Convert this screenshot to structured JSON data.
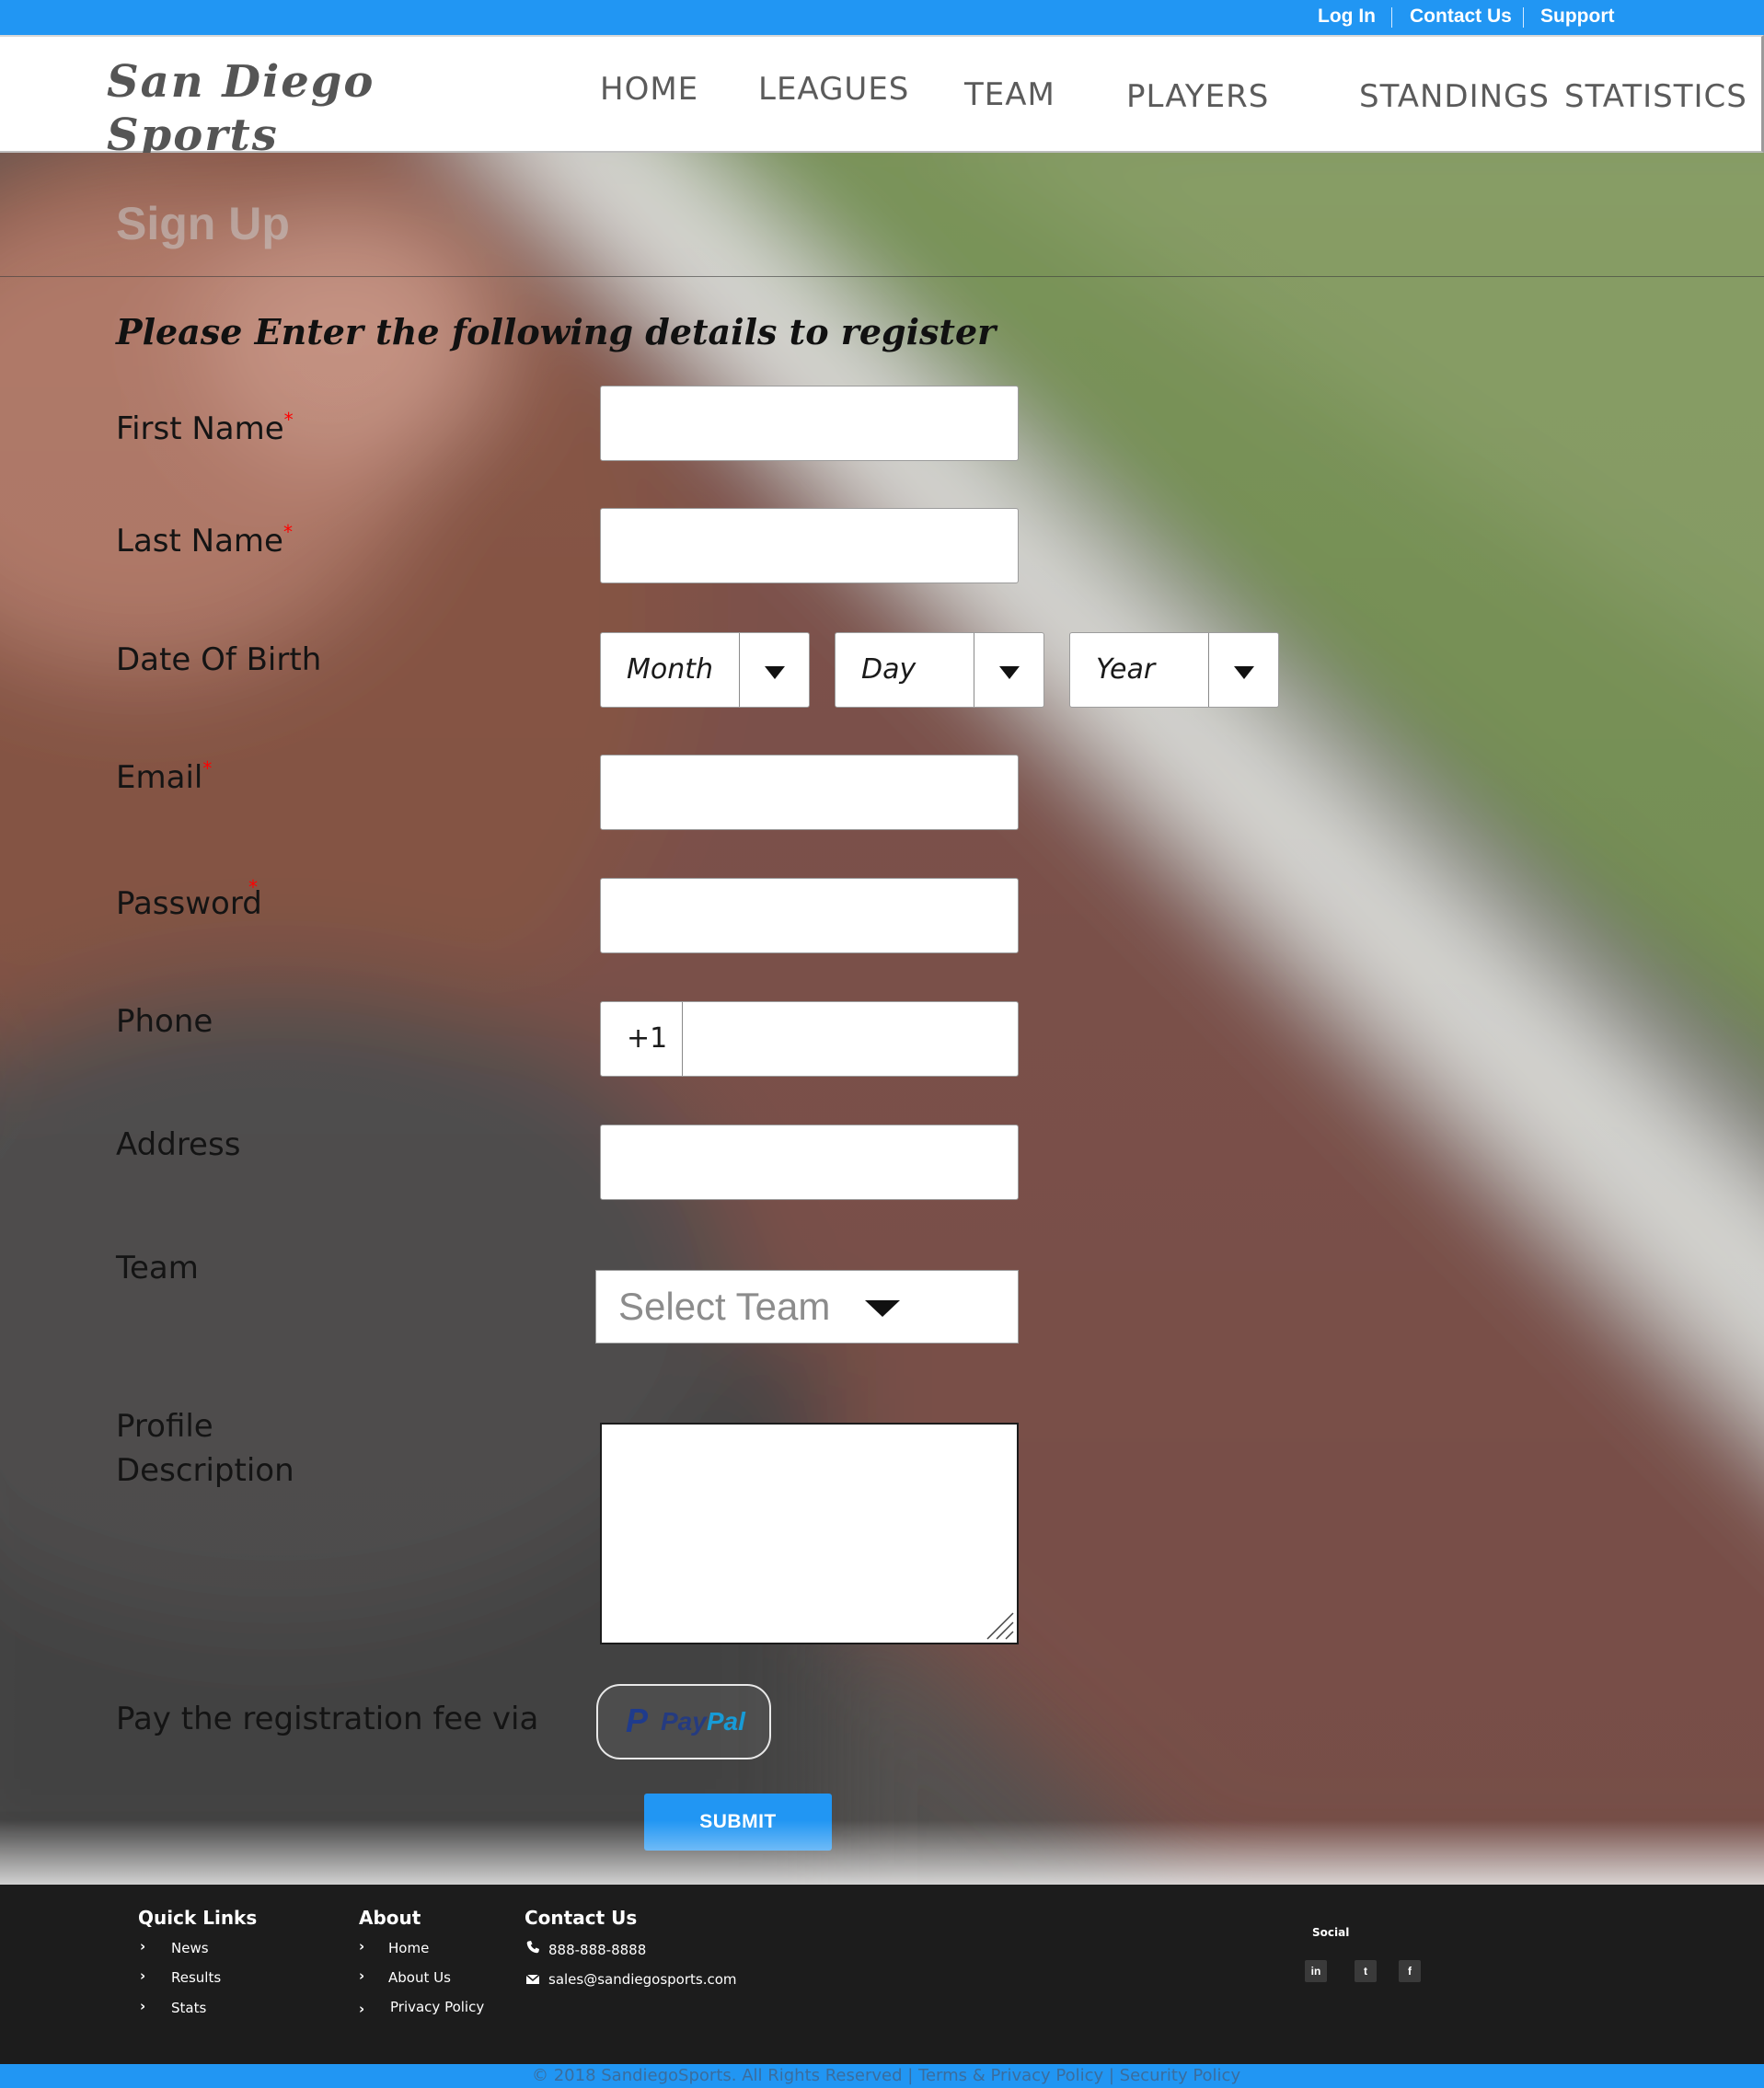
{
  "topbar": {
    "login": "Log In",
    "contact": "Contact Us",
    "support": "Support"
  },
  "brand": {
    "line1": "San Diego",
    "line2": "Sports"
  },
  "nav": [
    "HOME",
    "LEAGUES",
    "TEAM",
    "PLAYERS",
    "STANDINGS",
    "STATISTICS"
  ],
  "page": {
    "title": "Sign Up",
    "instructions": "Please Enter the following details to register"
  },
  "form": {
    "first_name": "First Name",
    "last_name": "Last Name",
    "dob": "Date Of Birth",
    "email": "Email",
    "password": "Password",
    "phone": "Phone",
    "address": "Address",
    "team": "Team",
    "profile_line1": "Profile",
    "profile_line2": "Description",
    "pay": "Pay the registration fee via",
    "required_mark": "*",
    "dob_month": "Month",
    "dob_day": "Day",
    "dob_year": "Year",
    "phone_code": "+1",
    "team_placeholder": "Select Team",
    "paypal_pay": "Pay",
    "paypal_pal": "Pal",
    "submit": "SUBMIT"
  },
  "footer": {
    "quick_links": {
      "heading": "Quick Links",
      "items": [
        "News",
        "Results",
        "Stats"
      ]
    },
    "about": {
      "heading": "About",
      "items": [
        "Home",
        "About Us",
        "Privacy Policy"
      ]
    },
    "contact": {
      "heading": "Contact Us",
      "phone": "888-888-8888",
      "email": "sales@sandiegosports.com"
    },
    "social": {
      "heading": "Social",
      "icons": [
        "linkedin-icon",
        "twitter-icon",
        "facebook-icon"
      ],
      "glyphs": [
        "in",
        "t",
        "f"
      ]
    },
    "copyright": "© 2018 SandiegoSports. All Rights Reserved | Terms & Privacy Policy | Security Policy"
  },
  "colors": {
    "accent": "#2196f3",
    "footer_bg": "#1c1c1c",
    "required": "#ff0000",
    "paypal_dark": "#253b80",
    "paypal_light": "#179bd7"
  }
}
